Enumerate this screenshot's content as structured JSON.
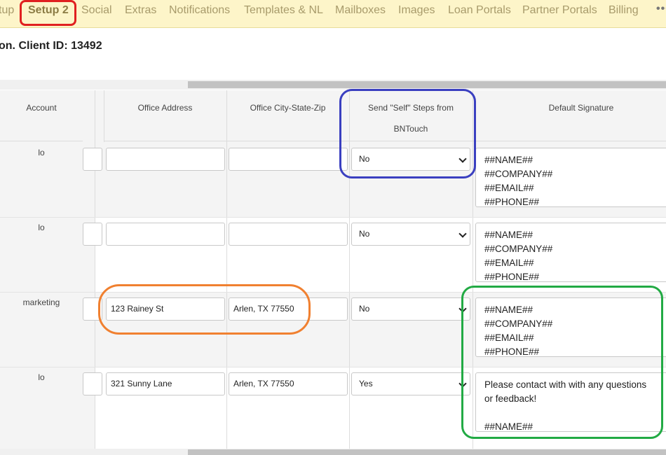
{
  "nav": {
    "tabs": [
      "tup",
      "Setup 2",
      "Social",
      "Extras",
      "Notifications",
      "Templates & NL",
      "Mailboxes",
      "Images",
      "Loan Portals",
      "Partner Portals",
      "Billing"
    ],
    "more": "•••"
  },
  "client_line": "on. Client ID: 13492",
  "table": {
    "headers": {
      "account": "Account",
      "office_address": "Office Address",
      "office_city": "Office City-State-Zip",
      "send_self_line1": "Send \"Self\" Steps from",
      "send_self_line2": "BNTouch",
      "default_signature": "Default Signature"
    },
    "rows": [
      {
        "account": "lo",
        "address": "",
        "city": "",
        "send_self": "No",
        "signature": "##NAME##\n##COMPANY##\n##EMAIL##\n##PHONE##"
      },
      {
        "account": "lo",
        "address": "",
        "city": "",
        "send_self": "No",
        "signature": "##NAME##\n##COMPANY##\n##EMAIL##\n##PHONE##"
      },
      {
        "account": "marketing",
        "address": "123 Rainey St",
        "city": "Arlen, TX 77550",
        "send_self": "No",
        "signature": "##NAME##\n##COMPANY##\n##EMAIL##\n##PHONE##"
      },
      {
        "account": "lo",
        "address": "321 Sunny Lane",
        "city": "Arlen, TX 77550",
        "send_self": "Yes",
        "signature": "Please contact with with any questions\nor feedback!\n\n##NAME##"
      }
    ]
  },
  "annotation_colors": {
    "red": "#e02020",
    "blue": "#3a3fc0",
    "orange": "#f08030",
    "green": "#22aa44"
  }
}
